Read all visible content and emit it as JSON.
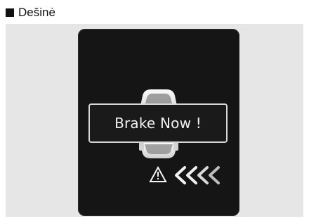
{
  "header": {
    "title": "Dešinė",
    "bullet_icon": "square-bullet-icon"
  },
  "display": {
    "message": "Brake Now !",
    "warning_icon": "warning-triangle-icon",
    "direction_icon": "right-side-approach-chevrons-icon"
  },
  "colors": {
    "screen": "#151515",
    "panel": "#e6e6e6",
    "text": "#f1f1f1",
    "chevron_light": "#f3f3f3",
    "chevron_dim": "#bdbdbd"
  }
}
